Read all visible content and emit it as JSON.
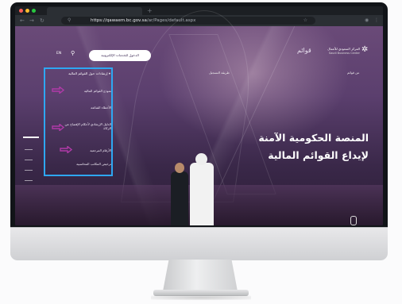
{
  "browser": {
    "url_host": "https://qawaem.bc.gov.sa",
    "url_path": "/ar/Pages/default.aspx",
    "tab_new_label": "+",
    "back_icon": "back-arrow-icon",
    "forward_icon": "forward-arrow-icon",
    "reload_icon": "reload-icon",
    "search_icon": "search-icon",
    "bookmark_icon": "star-icon"
  },
  "header": {
    "logo_ar": "المركز السعودي للأعمال",
    "logo_en": "Saudi Business Center",
    "qawaem_logo": "قوائم",
    "cta_label": "الدخول للخدمات الإلكترونية",
    "lang_label": "EN",
    "nav_about": "عن قوائم",
    "nav_register": "طريقة التسجيل"
  },
  "menu": {
    "title": "إرشادات حول القوائم المالية",
    "items": [
      {
        "label": "نموذج القوائم المالية"
      },
      {
        "label": "الأخطاء الشائعة"
      },
      {
        "label": "الدليل الإرشادي لأحكام الإفصاح عن الزكاة"
      },
      {
        "label": "الأرقام المرجعية"
      },
      {
        "label": "ترخيص المكاتب المحاسبية"
      }
    ]
  },
  "hero": {
    "line1": "المنصة الحكومية الآمنة",
    "line2": "لإيداع القوائم المالية"
  },
  "colors": {
    "highlight": "#2ea7f2",
    "arrow": "#b03aa8",
    "cta_text": "#3d2a55"
  }
}
